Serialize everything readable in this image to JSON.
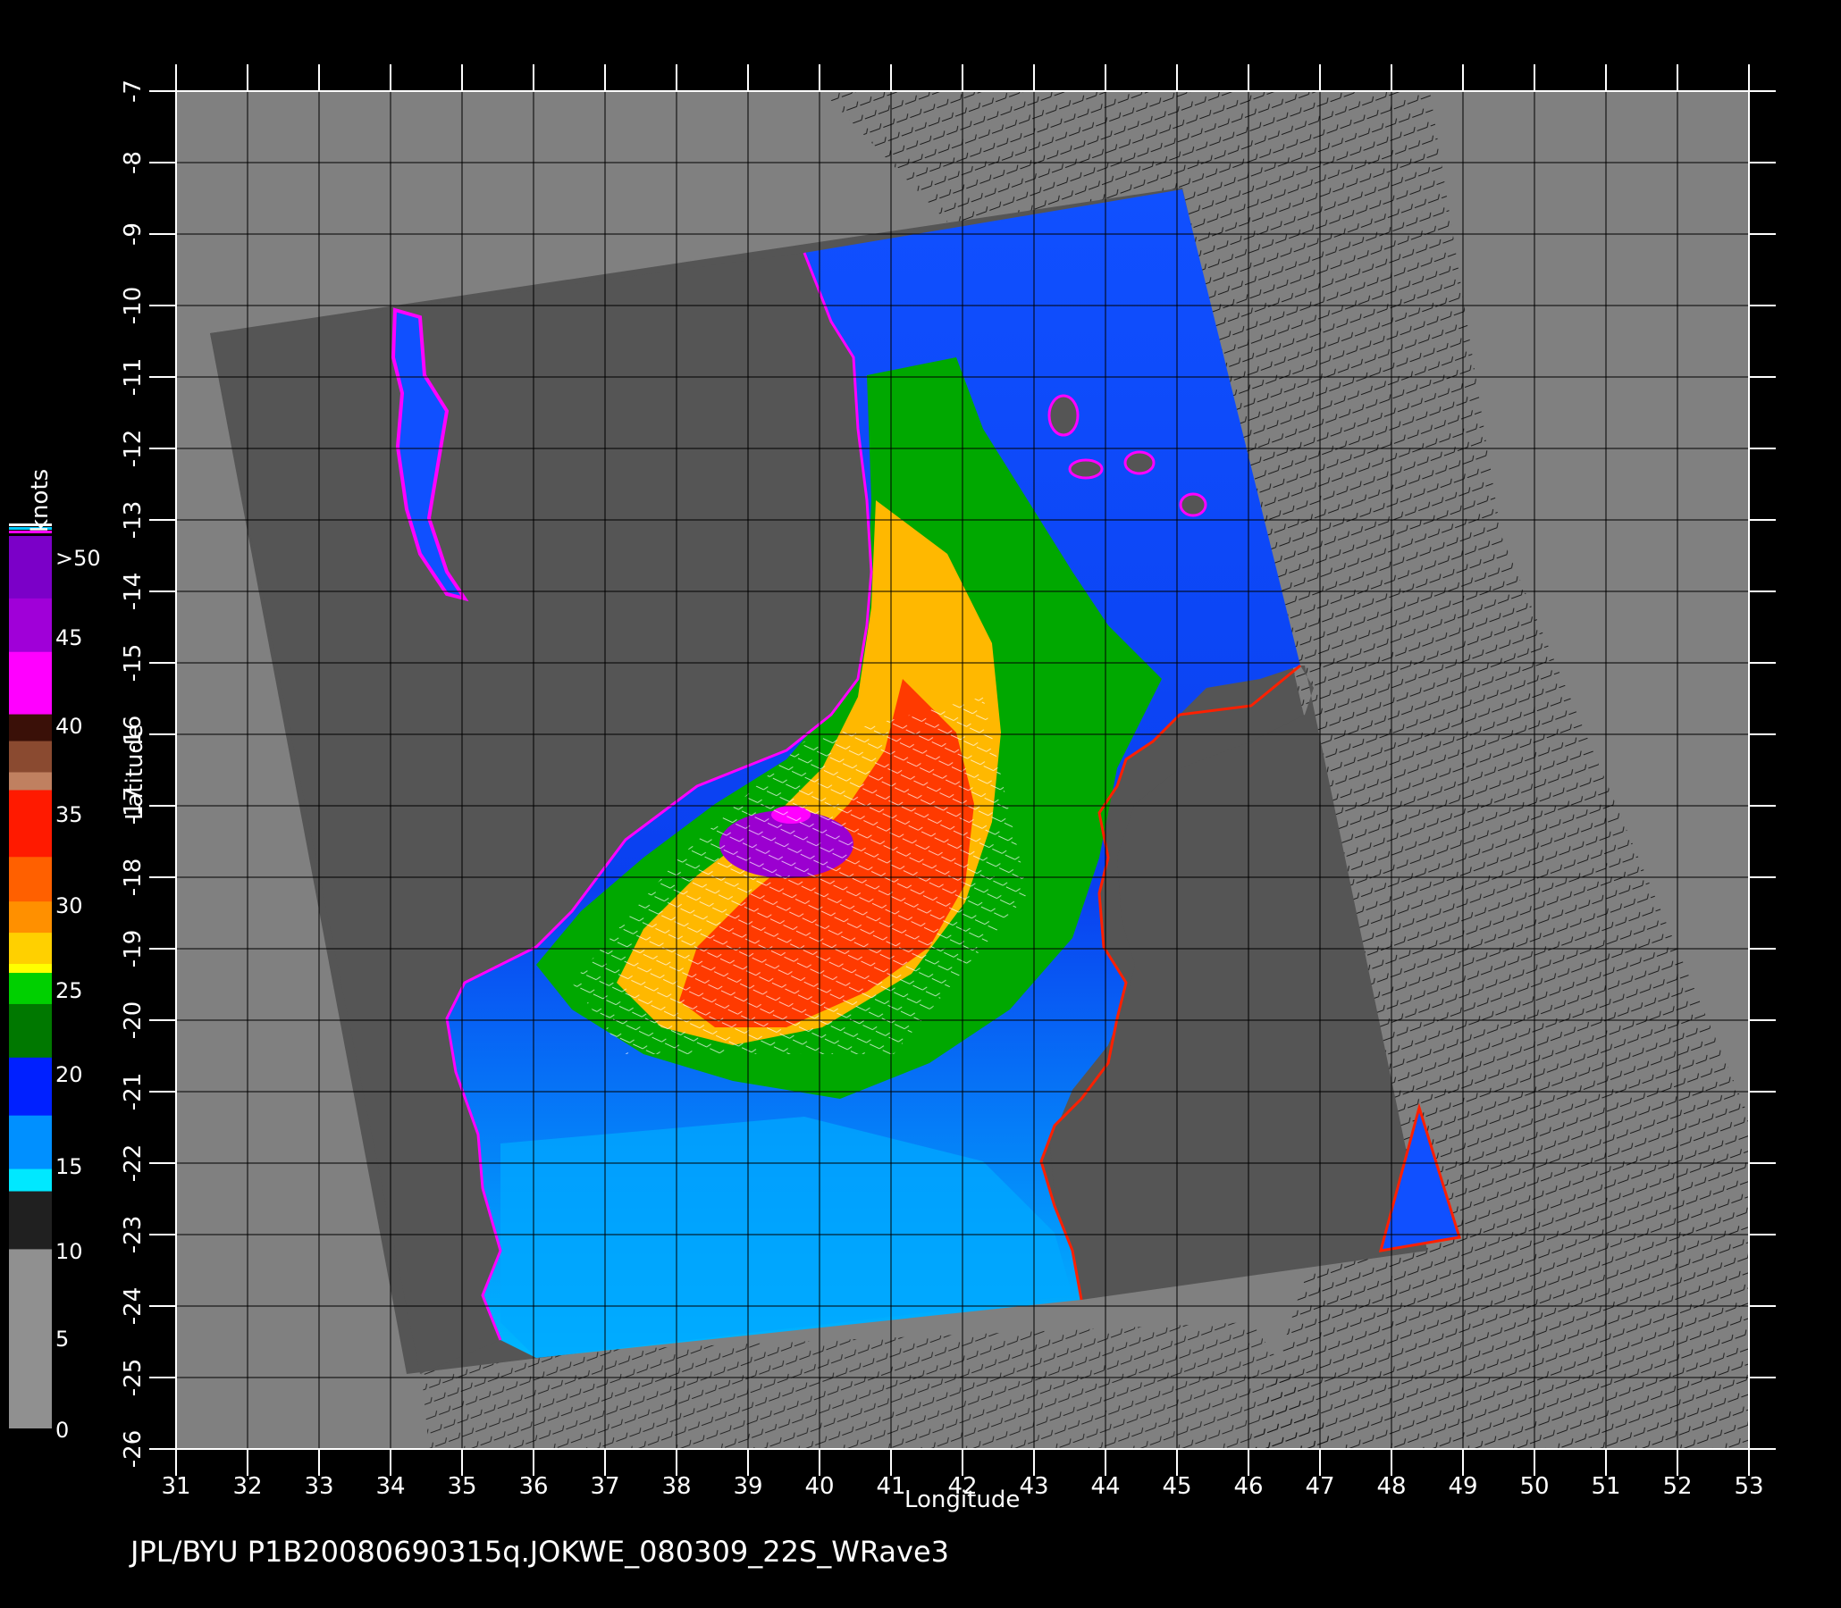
{
  "caption": "JPL/BYU  P1B20080690315q.JOKWE_080309_22S_WRave3",
  "axes": {
    "x_title": "Longitude",
    "y_title": "Latitude",
    "lon_range": [
      31,
      53
    ],
    "lat_range": [
      -26,
      -7
    ],
    "lon_ticks": [
      "31",
      "32",
      "33",
      "34",
      "35",
      "36",
      "37",
      "38",
      "39",
      "40",
      "41",
      "42",
      "43",
      "44",
      "45",
      "46",
      "47",
      "48",
      "49",
      "50",
      "51",
      "52",
      "53"
    ],
    "lat_ticks": [
      "-7",
      "-8",
      "-9",
      "-10",
      "-11",
      "-12",
      "-13",
      "-14",
      "-15",
      "-16",
      "-17",
      "-18",
      "-19",
      "-20",
      "-21",
      "-22",
      "-23",
      "-24",
      "-25",
      "-26"
    ]
  },
  "colorbar": {
    "unit": "knots",
    "labels": [
      ">50",
      "45",
      "40",
      "35",
      "30",
      "25",
      "20",
      "15",
      "10",
      "5",
      "0"
    ],
    "colors": [
      "#7b00c8",
      "#a000d8",
      "#ff00ff",
      "#4a1a10",
      "#b07050",
      "#ff2000",
      "#ff6a00",
      "#ffd000",
      "#00c000",
      "#0030ff",
      "#00c8ff",
      "#404040",
      "#a0a0a0"
    ]
  },
  "chart_data": {
    "type": "heatmap",
    "title": "",
    "xlabel": "Longitude",
    "ylabel": "Latitude",
    "xlim": [
      31,
      53
    ],
    "ylim": [
      -26,
      -7
    ],
    "value_unit": "knots",
    "scale": [
      0,
      50
    ],
    "features": [
      {
        "name": "cyclone-core",
        "lon": 39,
        "lat": -17.5,
        "value": 45
      },
      {
        "name": "high-wind-band",
        "lon": 40.5,
        "lat": -19,
        "value": 30
      }
    ]
  }
}
